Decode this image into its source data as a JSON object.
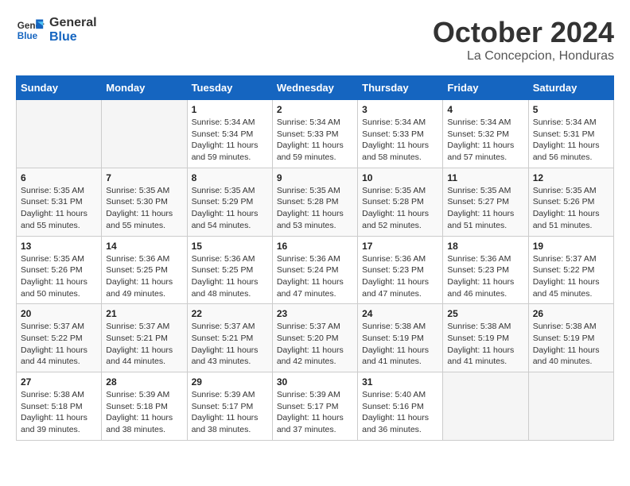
{
  "logo": {
    "line1": "General",
    "line2": "Blue"
  },
  "title": "October 2024",
  "subtitle": "La Concepcion, Honduras",
  "days_of_week": [
    "Sunday",
    "Monday",
    "Tuesday",
    "Wednesday",
    "Thursday",
    "Friday",
    "Saturday"
  ],
  "weeks": [
    [
      {
        "day": "",
        "info": ""
      },
      {
        "day": "",
        "info": ""
      },
      {
        "day": "1",
        "info": "Sunrise: 5:34 AM\nSunset: 5:34 PM\nDaylight: 11 hours\nand 59 minutes."
      },
      {
        "day": "2",
        "info": "Sunrise: 5:34 AM\nSunset: 5:33 PM\nDaylight: 11 hours\nand 59 minutes."
      },
      {
        "day": "3",
        "info": "Sunrise: 5:34 AM\nSunset: 5:33 PM\nDaylight: 11 hours\nand 58 minutes."
      },
      {
        "day": "4",
        "info": "Sunrise: 5:34 AM\nSunset: 5:32 PM\nDaylight: 11 hours\nand 57 minutes."
      },
      {
        "day": "5",
        "info": "Sunrise: 5:34 AM\nSunset: 5:31 PM\nDaylight: 11 hours\nand 56 minutes."
      }
    ],
    [
      {
        "day": "6",
        "info": "Sunrise: 5:35 AM\nSunset: 5:31 PM\nDaylight: 11 hours\nand 55 minutes."
      },
      {
        "day": "7",
        "info": "Sunrise: 5:35 AM\nSunset: 5:30 PM\nDaylight: 11 hours\nand 55 minutes."
      },
      {
        "day": "8",
        "info": "Sunrise: 5:35 AM\nSunset: 5:29 PM\nDaylight: 11 hours\nand 54 minutes."
      },
      {
        "day": "9",
        "info": "Sunrise: 5:35 AM\nSunset: 5:28 PM\nDaylight: 11 hours\nand 53 minutes."
      },
      {
        "day": "10",
        "info": "Sunrise: 5:35 AM\nSunset: 5:28 PM\nDaylight: 11 hours\nand 52 minutes."
      },
      {
        "day": "11",
        "info": "Sunrise: 5:35 AM\nSunset: 5:27 PM\nDaylight: 11 hours\nand 51 minutes."
      },
      {
        "day": "12",
        "info": "Sunrise: 5:35 AM\nSunset: 5:26 PM\nDaylight: 11 hours\nand 51 minutes."
      }
    ],
    [
      {
        "day": "13",
        "info": "Sunrise: 5:35 AM\nSunset: 5:26 PM\nDaylight: 11 hours\nand 50 minutes."
      },
      {
        "day": "14",
        "info": "Sunrise: 5:36 AM\nSunset: 5:25 PM\nDaylight: 11 hours\nand 49 minutes."
      },
      {
        "day": "15",
        "info": "Sunrise: 5:36 AM\nSunset: 5:25 PM\nDaylight: 11 hours\nand 48 minutes."
      },
      {
        "day": "16",
        "info": "Sunrise: 5:36 AM\nSunset: 5:24 PM\nDaylight: 11 hours\nand 47 minutes."
      },
      {
        "day": "17",
        "info": "Sunrise: 5:36 AM\nSunset: 5:23 PM\nDaylight: 11 hours\nand 47 minutes."
      },
      {
        "day": "18",
        "info": "Sunrise: 5:36 AM\nSunset: 5:23 PM\nDaylight: 11 hours\nand 46 minutes."
      },
      {
        "day": "19",
        "info": "Sunrise: 5:37 AM\nSunset: 5:22 PM\nDaylight: 11 hours\nand 45 minutes."
      }
    ],
    [
      {
        "day": "20",
        "info": "Sunrise: 5:37 AM\nSunset: 5:22 PM\nDaylight: 11 hours\nand 44 minutes."
      },
      {
        "day": "21",
        "info": "Sunrise: 5:37 AM\nSunset: 5:21 PM\nDaylight: 11 hours\nand 44 minutes."
      },
      {
        "day": "22",
        "info": "Sunrise: 5:37 AM\nSunset: 5:21 PM\nDaylight: 11 hours\nand 43 minutes."
      },
      {
        "day": "23",
        "info": "Sunrise: 5:37 AM\nSunset: 5:20 PM\nDaylight: 11 hours\nand 42 minutes."
      },
      {
        "day": "24",
        "info": "Sunrise: 5:38 AM\nSunset: 5:19 PM\nDaylight: 11 hours\nand 41 minutes."
      },
      {
        "day": "25",
        "info": "Sunrise: 5:38 AM\nSunset: 5:19 PM\nDaylight: 11 hours\nand 41 minutes."
      },
      {
        "day": "26",
        "info": "Sunrise: 5:38 AM\nSunset: 5:19 PM\nDaylight: 11 hours\nand 40 minutes."
      }
    ],
    [
      {
        "day": "27",
        "info": "Sunrise: 5:38 AM\nSunset: 5:18 PM\nDaylight: 11 hours\nand 39 minutes."
      },
      {
        "day": "28",
        "info": "Sunrise: 5:39 AM\nSunset: 5:18 PM\nDaylight: 11 hours\nand 38 minutes."
      },
      {
        "day": "29",
        "info": "Sunrise: 5:39 AM\nSunset: 5:17 PM\nDaylight: 11 hours\nand 38 minutes."
      },
      {
        "day": "30",
        "info": "Sunrise: 5:39 AM\nSunset: 5:17 PM\nDaylight: 11 hours\nand 37 minutes."
      },
      {
        "day": "31",
        "info": "Sunrise: 5:40 AM\nSunset: 5:16 PM\nDaylight: 11 hours\nand 36 minutes."
      },
      {
        "day": "",
        "info": ""
      },
      {
        "day": "",
        "info": ""
      }
    ]
  ]
}
